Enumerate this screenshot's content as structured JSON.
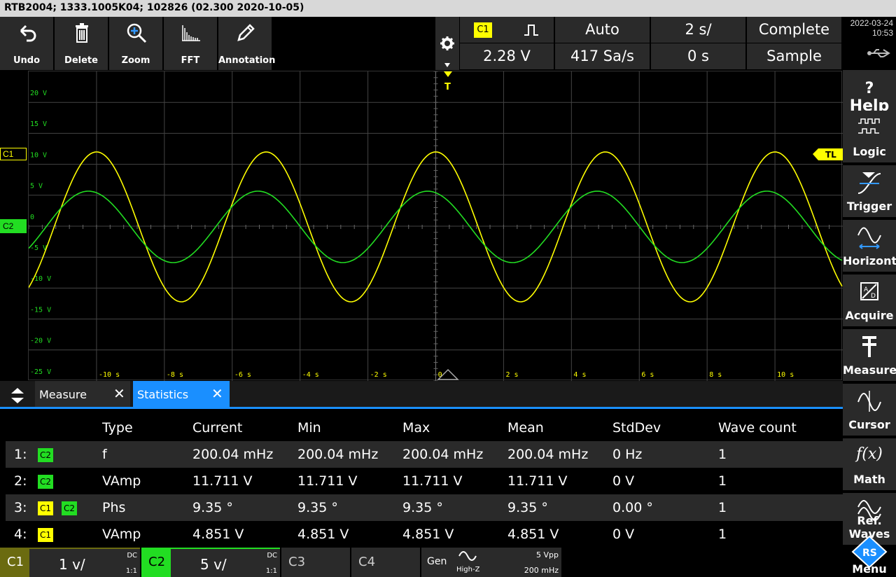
{
  "title": "RTB2004; 1333.1005K04; 102826 (02.300 2020-10-05)",
  "toolbar": {
    "undo": "Undo",
    "delete": "Delete",
    "zoom": "Zoom",
    "fft": "FFT",
    "annotation": "Annotation"
  },
  "trigger": {
    "source": "C1",
    "level": "2.28 V",
    "mode": "Auto",
    "rate": "417 Sa/s",
    "timebase": "2 s/",
    "offset": "0 s",
    "status": "Complete",
    "acq": "Sample"
  },
  "datetime": {
    "date": "2022-03-24",
    "time": "10:53"
  },
  "right_menu": [
    "Help",
    "Logic",
    "Trigger",
    "Horizontal",
    "Acquire",
    "Measure",
    "Cursor",
    "Math",
    "Ref. Waves",
    "Menu"
  ],
  "scope": {
    "y_labels": [
      "20 V",
      "15 V",
      "10 V",
      "5 V",
      "0",
      "-5 V",
      "-10 V",
      "-15 V",
      "-20 V",
      "-25 V"
    ],
    "x_labels": [
      "-10 s",
      "-8 s",
      "-6 s",
      "-4 s",
      "-2 s",
      "0 s",
      "2 s",
      "4 s",
      "6 s",
      "8 s",
      "10 s"
    ],
    "c1_marker": "C1",
    "c2_marker": "C2",
    "tl_marker": "TL",
    "trig_marker": "T",
    "c1_color": "#ffff00",
    "c2_color": "#22dd22"
  },
  "tabs": {
    "measure": "Measure",
    "statistics": "Statistics"
  },
  "stats": {
    "headers": [
      "Type",
      "Current",
      "Min",
      "Max",
      "Mean",
      "StdDev",
      "Wave count"
    ],
    "rows": [
      {
        "idx": "1:",
        "ch": [
          "C2"
        ],
        "type": "f",
        "current": "200.04 mHz",
        "min": "200.04 mHz",
        "max": "200.04 mHz",
        "mean": "200.04 mHz",
        "std": "0 Hz",
        "count": "1"
      },
      {
        "idx": "2:",
        "ch": [
          "C2"
        ],
        "type": "VAmp",
        "current": "11.711 V",
        "min": "11.711 V",
        "max": "11.711 V",
        "mean": "11.711 V",
        "std": "0 V",
        "count": "1"
      },
      {
        "idx": "3:",
        "ch": [
          "C1",
          "C2"
        ],
        "type": "Phs",
        "current": "9.35 °",
        "min": "9.35 °",
        "max": "9.35 °",
        "mean": "9.35 °",
        "std": "0.00 °",
        "count": "1"
      },
      {
        "idx": "4:",
        "ch": [
          "C1"
        ],
        "type": "VAmp",
        "current": "4.851 V",
        "min": "4.851 V",
        "max": "4.851 V",
        "mean": "4.851 V",
        "std": "0 V",
        "count": "1"
      }
    ]
  },
  "channels": {
    "c1": {
      "name": "C1",
      "scale": "1 v/",
      "coupling": "DC",
      "ratio": "1:1"
    },
    "c2": {
      "name": "C2",
      "scale": "5 v/",
      "coupling": "DC",
      "ratio": "1:1"
    },
    "c3": {
      "name": "C3"
    },
    "c4": {
      "name": "C4"
    },
    "gen": {
      "name": "Gen",
      "impedance": "High-Z",
      "amplitude": "5 Vpp",
      "freq": "200 mHz"
    }
  }
}
